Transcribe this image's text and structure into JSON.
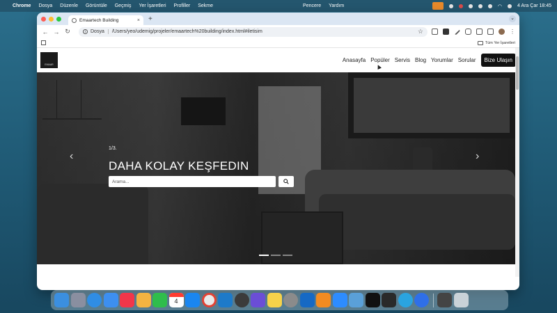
{
  "menubar": {
    "app_name": "Chrome",
    "menus": [
      "Dosya",
      "Düzenle",
      "Görüntüle",
      "Geçmiş",
      "Yer İşaretleri",
      "Profiller",
      "Sekme"
    ],
    "right_menus": [
      "Pencere",
      "Yardım"
    ],
    "datetime": "4 Ara Çar  18:45"
  },
  "browser": {
    "tab_title": "Emaartech Building",
    "address_scheme": "Dosya",
    "address_url": "/Users/yeo/udemig/projeler/emaartech%20building/index.html#iletisim",
    "bookmarks_all_label": "Tüm Yer İşaretleri"
  },
  "site": {
    "logo_text": "EMAAR",
    "nav": {
      "links": [
        "Anasayfa",
        "Popüler",
        "Servis",
        "Blog",
        "Yorumlar",
        "Sorular"
      ],
      "cta": "Bize Ulaşın"
    },
    "hero": {
      "counter": "1/3.",
      "headline": "DAHA KOLAY KEŞFEDIN",
      "search_placeholder": "Arama...",
      "slide_count": 3,
      "active_slide": 1
    }
  },
  "dock": {
    "calendar_month": "ARA",
    "calendar_day": "4",
    "apps": [
      "finder-icon",
      "launchpad-icon",
      "safari-icon",
      "mail-icon",
      "music-icon",
      "photos-icon",
      "facetime-icon",
      "calendar-icon",
      "app-store-icon",
      "chrome-icon",
      "vscode-icon",
      "quicktime-icon",
      "imovie-icon",
      "notes-icon",
      "system-settings-icon",
      "outlook-icon",
      "pages-icon",
      "zoom-icon",
      "preview-icon",
      "github-icon",
      "terminal-icon",
      "telegram-icon",
      "screencast-icon",
      "calculator-icon",
      "trash-icon"
    ],
    "colors": {
      "finder": "#3b8fe0",
      "launchpad": "#8a8fa0",
      "safari": "#2f8de4",
      "mail": "#3d8ff0",
      "music": "#f2364a",
      "photos": "#f3b341",
      "facetime": "#2fbd4c",
      "appstore": "#1a86f0",
      "chrome": "#e9e9e9",
      "vscode": "#1d7ac9",
      "quicktime": "#3b3b3b",
      "imovie": "#6b4ed6",
      "notes": "#f6d24a",
      "settings": "#8b8b8b",
      "outlook": "#1669c4",
      "pages": "#f28b22",
      "zoom": "#2d8cff",
      "preview": "#5aa0d8",
      "github": "#111111",
      "terminal": "#2a2a2a",
      "telegram": "#2aa4e0",
      "screencast": "#2f6fe8",
      "calculator": "#444444",
      "trash": "#c9d2d8"
    }
  }
}
